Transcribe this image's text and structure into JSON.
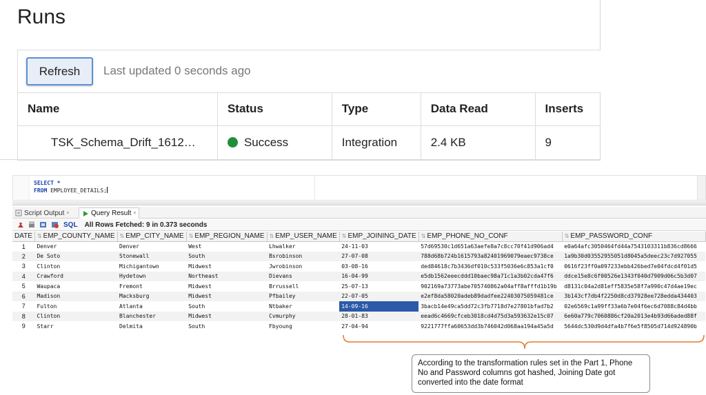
{
  "runs": {
    "title": "Runs",
    "refresh_label": "Refresh",
    "last_updated": "Last updated 0 seconds ago",
    "columns": [
      "Name",
      "Status",
      "Type",
      "Data Read",
      "Inserts"
    ],
    "row": {
      "name": "TSK_Schema_Drift_1612…",
      "status": "Success",
      "status_color": "#1f8f3a",
      "type": "Integration",
      "data_read": "2.4 KB",
      "inserts": "9"
    }
  },
  "editor": {
    "line1_kw": "SELECT",
    "line1_rest": " *",
    "line2_kw": "FROM",
    "line2_rest": " EMPLOYEE_DETAILS;"
  },
  "tabs": {
    "script_output": "Script Output",
    "query_result": "Query Result",
    "close": "×"
  },
  "toolbar": {
    "sql_label": "SQL",
    "status": "All Rows Fetched: 9 in 0.373 seconds"
  },
  "grid": {
    "columns": [
      "DATE",
      "EMP_COUNTY_NAME",
      "EMP_CITY_NAME",
      "EMP_REGION_NAME",
      "EMP_USER_NAME",
      "EMP_JOINING_DATE",
      "EMP_PHONE_NO_CONF",
      "EMP_PASSWORD_CONF"
    ],
    "rows": [
      [
        "1",
        "Denver",
        "Denver",
        "West",
        "Lhwalker",
        "24-11-03",
        "57d69530c1d651a63aefe8a7c8cc70f41d906ad4",
        "e0a64afc3050464fd44a7543103311b836cd8666"
      ],
      [
        "2",
        "De Soto",
        "Stonewall",
        "South",
        "Bsrobinson",
        "27-07-08",
        "788d68b724b1615793a82401969079eaec9738ce",
        "1a9b30d03552955051d8045a5deec23c7d927055"
      ],
      [
        "3",
        "Clinton",
        "Michigantown",
        "Midwest",
        "Jwrobinson",
        "03-08-16",
        "ded84618c7b3436df010c533f5036e6c853a1cf0",
        "0616f23ff0a097233ebb426bed7e04fdcd4f01d5"
      ],
      [
        "4",
        "Crawford",
        "Hydetown",
        "Northeast",
        "Dievans",
        "16-04-99",
        "e5db1562eeecddd10baec98a71c1a3b02cda47f6",
        "ddce15e8c6f00526e1343f040d7909d06c5b3d07"
      ],
      [
        "5",
        "Waupaca",
        "Fremont",
        "Midwest",
        "Brrussell",
        "25-07-13",
        "902169a73773abe705740862a04aff8afffd1b19b",
        "d8131c04a2d81eff5835e58f7a990c47d4ae19ec"
      ],
      [
        "6",
        "Madison",
        "Macksburg",
        "Midwest",
        "Pfbailey",
        "22-07-05",
        "e2ef8da58020adeb89dadfee22403075059481ce",
        "3b143cf7db4f2250d8cd37928ee728edda434403"
      ],
      [
        "7",
        "Fulton",
        "Atlanta",
        "South",
        "Ntbaker",
        "14-09-16",
        "3bacb14e49ca5dd72c3fb7718d7e27801bfad7b2",
        "02e6569c1a99ff33a6b7e04f6ec6d7088c84d4bb"
      ],
      [
        "8",
        "Clinton",
        "Blanchester",
        "Midwest",
        "Cvmurphy",
        "28-01-83",
        "eead6c4669cfceb3018cd4d75d3a593632e15c07",
        "6e60a779c7060886cf20a2013e4b93d66aded88f"
      ],
      [
        "9",
        "Starr",
        "Delmita",
        "South",
        "Fbyoung",
        "27-04-94",
        "9221777ffa60653dd3b746042d068aa194a45a5d",
        "5644dc530d9d4dfa4b7f6e5f8505d714d924890b"
      ]
    ],
    "selected_row": 7,
    "selected_col": 5,
    "selection_color": "#2a5aa8"
  },
  "annotation": {
    "text": "According to the transformation rules set in the Part 1, Phone No and Password columns got hashed, Joining Date got converted into the date format",
    "color": "#e07a2e"
  }
}
